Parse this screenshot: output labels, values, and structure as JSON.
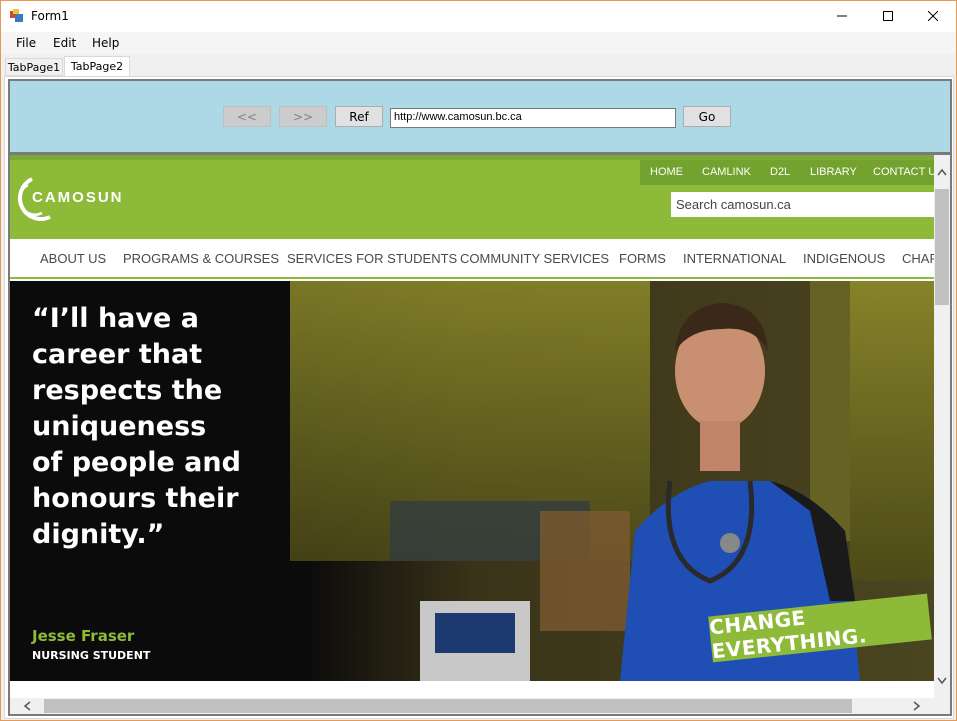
{
  "window": {
    "title": "Form1"
  },
  "menu": {
    "items": [
      {
        "label": "File"
      },
      {
        "label": "Edit"
      },
      {
        "label": "Help"
      }
    ]
  },
  "tabs": [
    {
      "label": "TabPage1",
      "selected": false
    },
    {
      "label": "TabPage2",
      "selected": true
    }
  ],
  "browser": {
    "back_label": "<<",
    "forward_label": ">>",
    "refresh_label": "Ref",
    "url_value": "http://www.camosun.bc.ca",
    "go_label": "Go",
    "panel_color": "#add8e6"
  },
  "site": {
    "logo_text": "CAMOSUN",
    "top_links": [
      "HOME",
      "CAMLINK",
      "D2L",
      "LIBRARY",
      "CONTACT US"
    ],
    "search_placeholder": "Search camosun.ca",
    "nav": [
      "ABOUT US",
      "PROGRAMS & COURSES",
      "SERVICES FOR STUDENTS",
      "COMMUNITY SERVICES",
      "FORMS",
      "INTERNATIONAL",
      "INDIGENOUS",
      "CHARITABLE"
    ],
    "hero": {
      "quote_lines": [
        "“I’ll have a",
        "career that",
        "respects the",
        "uniqueness",
        "of people and",
        "honours their",
        "dignity.”"
      ],
      "name": "Jesse Fraser",
      "role": "NURSING STUDENT",
      "cta": "CHANGE EVERYTHING."
    },
    "brand_green": "#8dba38"
  }
}
